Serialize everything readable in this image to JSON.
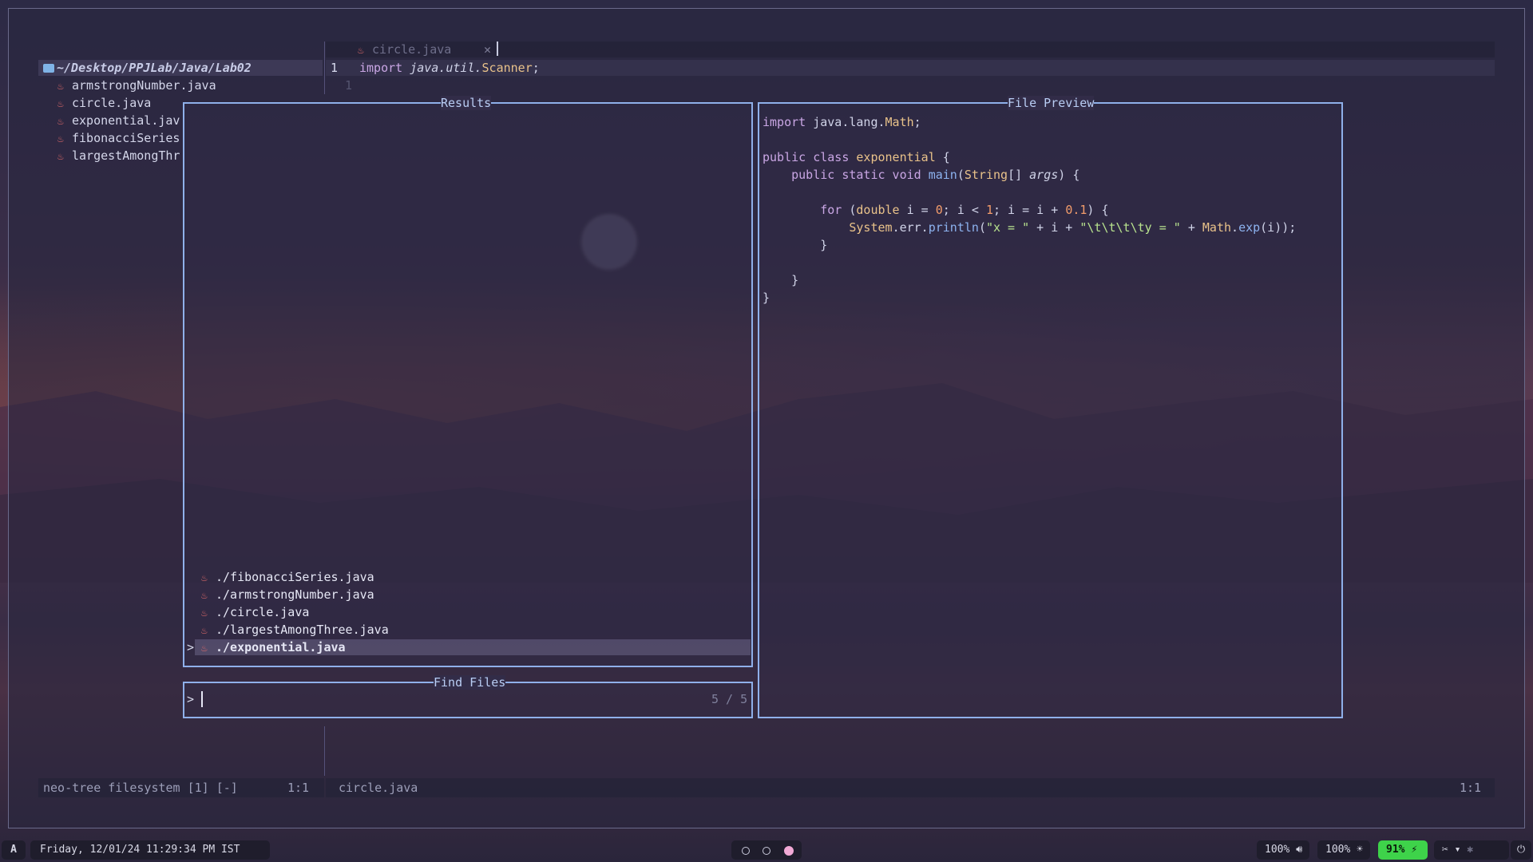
{
  "tree": {
    "root": "~/Desktop/PPJLab/Java/Lab02",
    "items": [
      "armstrongNumber.java",
      "circle.java",
      "exponential.jav",
      "fibonacciSeries",
      "largestAmongThr"
    ]
  },
  "editor": {
    "tab_label": "circle.java",
    "tab_close": "✕",
    "line_numbers": [
      "1",
      "1"
    ],
    "code": {
      "kw": "import",
      "pkg": "java.util.",
      "cls": "Scanner",
      "semi": ";"
    }
  },
  "results": {
    "title": "Results",
    "items": [
      "./fibonacciSeries.java",
      "./armstrongNumber.java",
      "./circle.java",
      "./largestAmongThree.java",
      "./exponential.java"
    ],
    "selected_marker": ">"
  },
  "find": {
    "title": "Find Files",
    "prompt": ">",
    "query": "",
    "counter": "5 / 5"
  },
  "preview": {
    "title": "File Preview",
    "lines": {
      "l1_kw": "import",
      "l1_pkg": " java.lang.",
      "l1_cls": "Math",
      "l1_end": ";",
      "l3_kw": "public class",
      "l3_cls": " exponential",
      "l3_end": " {",
      "l4_kw": "    public static void",
      "l4_fn": " main",
      "l4_p1": "(",
      "l4_cls": "String",
      "l4_p2": "[] ",
      "l4_arg": "args",
      "l4_end": ") {",
      "l6_kw": "        for",
      "l6_a": " (",
      "l6_kw2": "double",
      "l6_b": " i = ",
      "l6_n1": "0",
      "l6_c": "; i < ",
      "l6_n2": "1",
      "l6_d": "; i = i + ",
      "l6_n3": "0.1",
      "l6_e": ") {",
      "l7_cls": "            System",
      "l7_a": ".err.",
      "l7_fn": "println",
      "l7_b": "(",
      "l7_s1": "\"x = \"",
      "l7_c": " + i + ",
      "l7_s2": "\"\\t\\t\\t\\ty = \"",
      "l7_d": " + ",
      "l7_cls2": "Math",
      "l7_e": ".",
      "l7_fn2": "exp",
      "l7_f": "(i));",
      "l8": "        }",
      "l10": "    }",
      "l11": "}"
    }
  },
  "status": {
    "left": "neo-tree filesystem [1] [-]",
    "left_pos": "1:1",
    "file": "circle.java",
    "right_pos": "1:1"
  },
  "taskbar": {
    "logo": "A",
    "datetime": "Friday,  12/01/24  11:29:34 PM IST",
    "volume": "100%",
    "brightness": "100%",
    "battery": "91%",
    "colors": {
      "battery": "#3ed34a",
      "active_workspace": "#f1a9d5"
    }
  }
}
